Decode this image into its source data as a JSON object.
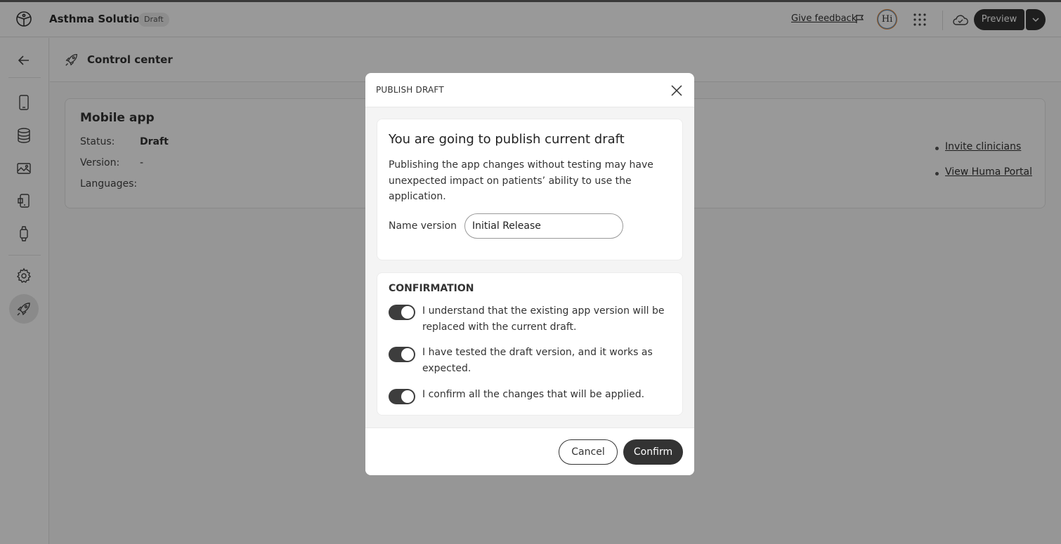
{
  "header": {
    "app_title": "Asthma Solution",
    "draft_badge": "Draft",
    "feedback": "Give feedback",
    "avatar_initials": "Hi",
    "preview_label": "Preview"
  },
  "sidebar": {
    "items": [
      {
        "name": "back",
        "icon": "arrow-left-icon"
      },
      {
        "name": "mobile",
        "icon": "mobile-icon"
      },
      {
        "name": "database",
        "icon": "database-icon"
      },
      {
        "name": "media",
        "icon": "image-icon"
      },
      {
        "name": "modules",
        "icon": "module-icon"
      },
      {
        "name": "wearables",
        "icon": "watch-icon"
      },
      {
        "name": "settings",
        "icon": "gear-icon"
      },
      {
        "name": "control-center",
        "icon": "rocket-icon",
        "active": true
      }
    ]
  },
  "page": {
    "title": "Control center"
  },
  "card": {
    "title": "Mobile app",
    "status_label": "Status:",
    "status_value": "Draft",
    "version_label": "Version:",
    "version_value": "-",
    "languages_label": "Languages:",
    "links": [
      "Invite clinicians",
      "View Huma Portal"
    ]
  },
  "modal": {
    "title": "PUBLISH DRAFT",
    "heading": "You are going to publish current draft",
    "description": "Publishing the app changes without testing may have unexpected impact on patients’ ability to use the application.",
    "name_version_label": "Name version",
    "name_version_value": "Initial Release",
    "confirmation_title": "CONFIRMATION",
    "confirmations": [
      {
        "text": "I understand that the existing app version will be replaced with the current draft.",
        "checked": true
      },
      {
        "text": "I have tested the draft version, and it works as expected.",
        "checked": true
      },
      {
        "text": "I confirm all the changes that will be applied.",
        "checked": true
      }
    ],
    "cancel_label": "Cancel",
    "confirm_label": "Confirm"
  },
  "colors": {
    "primary": "#333333",
    "avatar_ring": "#e98a37",
    "overlay": "#000000"
  }
}
